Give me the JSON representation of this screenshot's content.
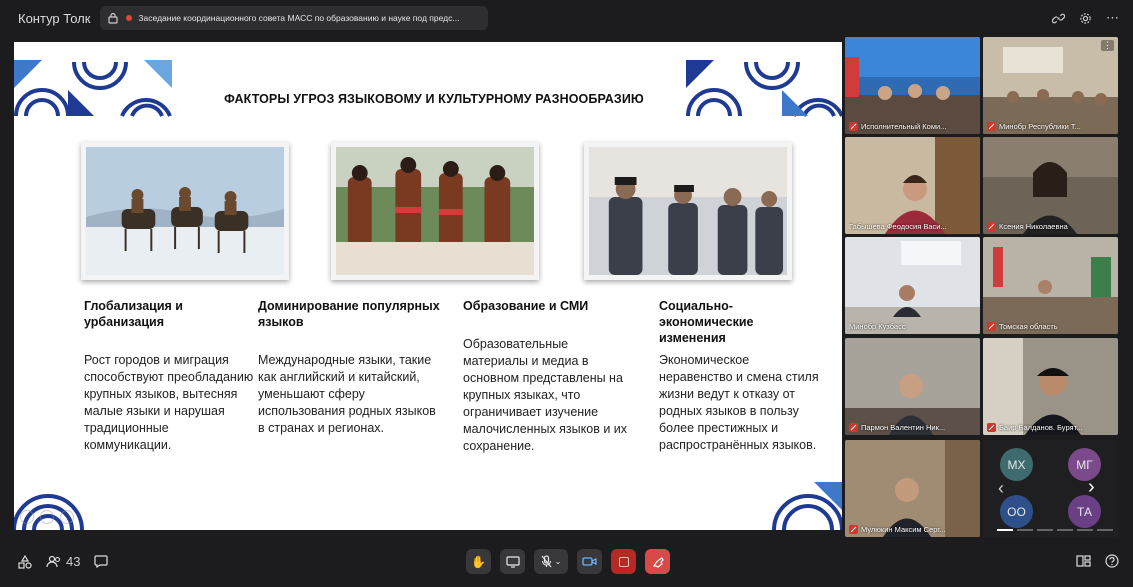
{
  "app": {
    "title": "Контур Толк"
  },
  "meeting": {
    "title": "Заседание координационного совета МАСС по образованию и науке под предс..."
  },
  "slide": {
    "title": "ФАКТОРЫ УГРОЗ ЯЗЫКОВОМУ И КУЛЬТУРНОМУ РАЗНООБРАЗИЮ",
    "columns": [
      {
        "heading": "Глобализация и урбанизация",
        "body": "Рост городов и миграция способствуют преобладанию крупных языков, вытесняя малые языки и нарушая традиционные коммуникации."
      },
      {
        "heading": "Доминирование популярных языков",
        "body": "Международные языки, такие как английский и китайский, уменьшают сферу использования родных языков в странах и регионах."
      },
      {
        "heading": "Образование и СМИ",
        "body": "Образовательные материалы и медиа в основном представлены на крупных языках, что ограничивает изучение малочисленных языков и их сохранение."
      },
      {
        "heading": "Социально-экономические изменения",
        "body": "Экономическое неравенство и смена стиля жизни ведут к отказу от родных языков в пользу более престижных и распространённых языков."
      }
    ]
  },
  "participants": [
    {
      "name": "Исполнительный Коми..."
    },
    {
      "name": "Минобр Республики Т..."
    },
    {
      "name": "Габышева Феодосия Васи..."
    },
    {
      "name": "Ксения Николаевна"
    },
    {
      "name": "Минобр Кузбасс"
    },
    {
      "name": "Томская область"
    },
    {
      "name": "Пармон Валентин Ник..."
    },
    {
      "name": "Баир Балданов. Бурят..."
    },
    {
      "name": "Мулюкин Максим Серг..."
    }
  ],
  "avatars": [
    {
      "initials": "МХ",
      "color": "#3d6b6e"
    },
    {
      "initials": "МГ",
      "color": "#7a4a8a"
    },
    {
      "initials": "ОО",
      "color": "#2f4f8a"
    },
    {
      "initials": "ТА",
      "color": "#6a3f86"
    }
  ],
  "toolbar": {
    "participants_count": "43"
  },
  "colors": {
    "accent": "#4aa3ff",
    "mute": "#d0362b",
    "hangup": "#d84a4a",
    "slide_deco": "#1f3a93"
  }
}
